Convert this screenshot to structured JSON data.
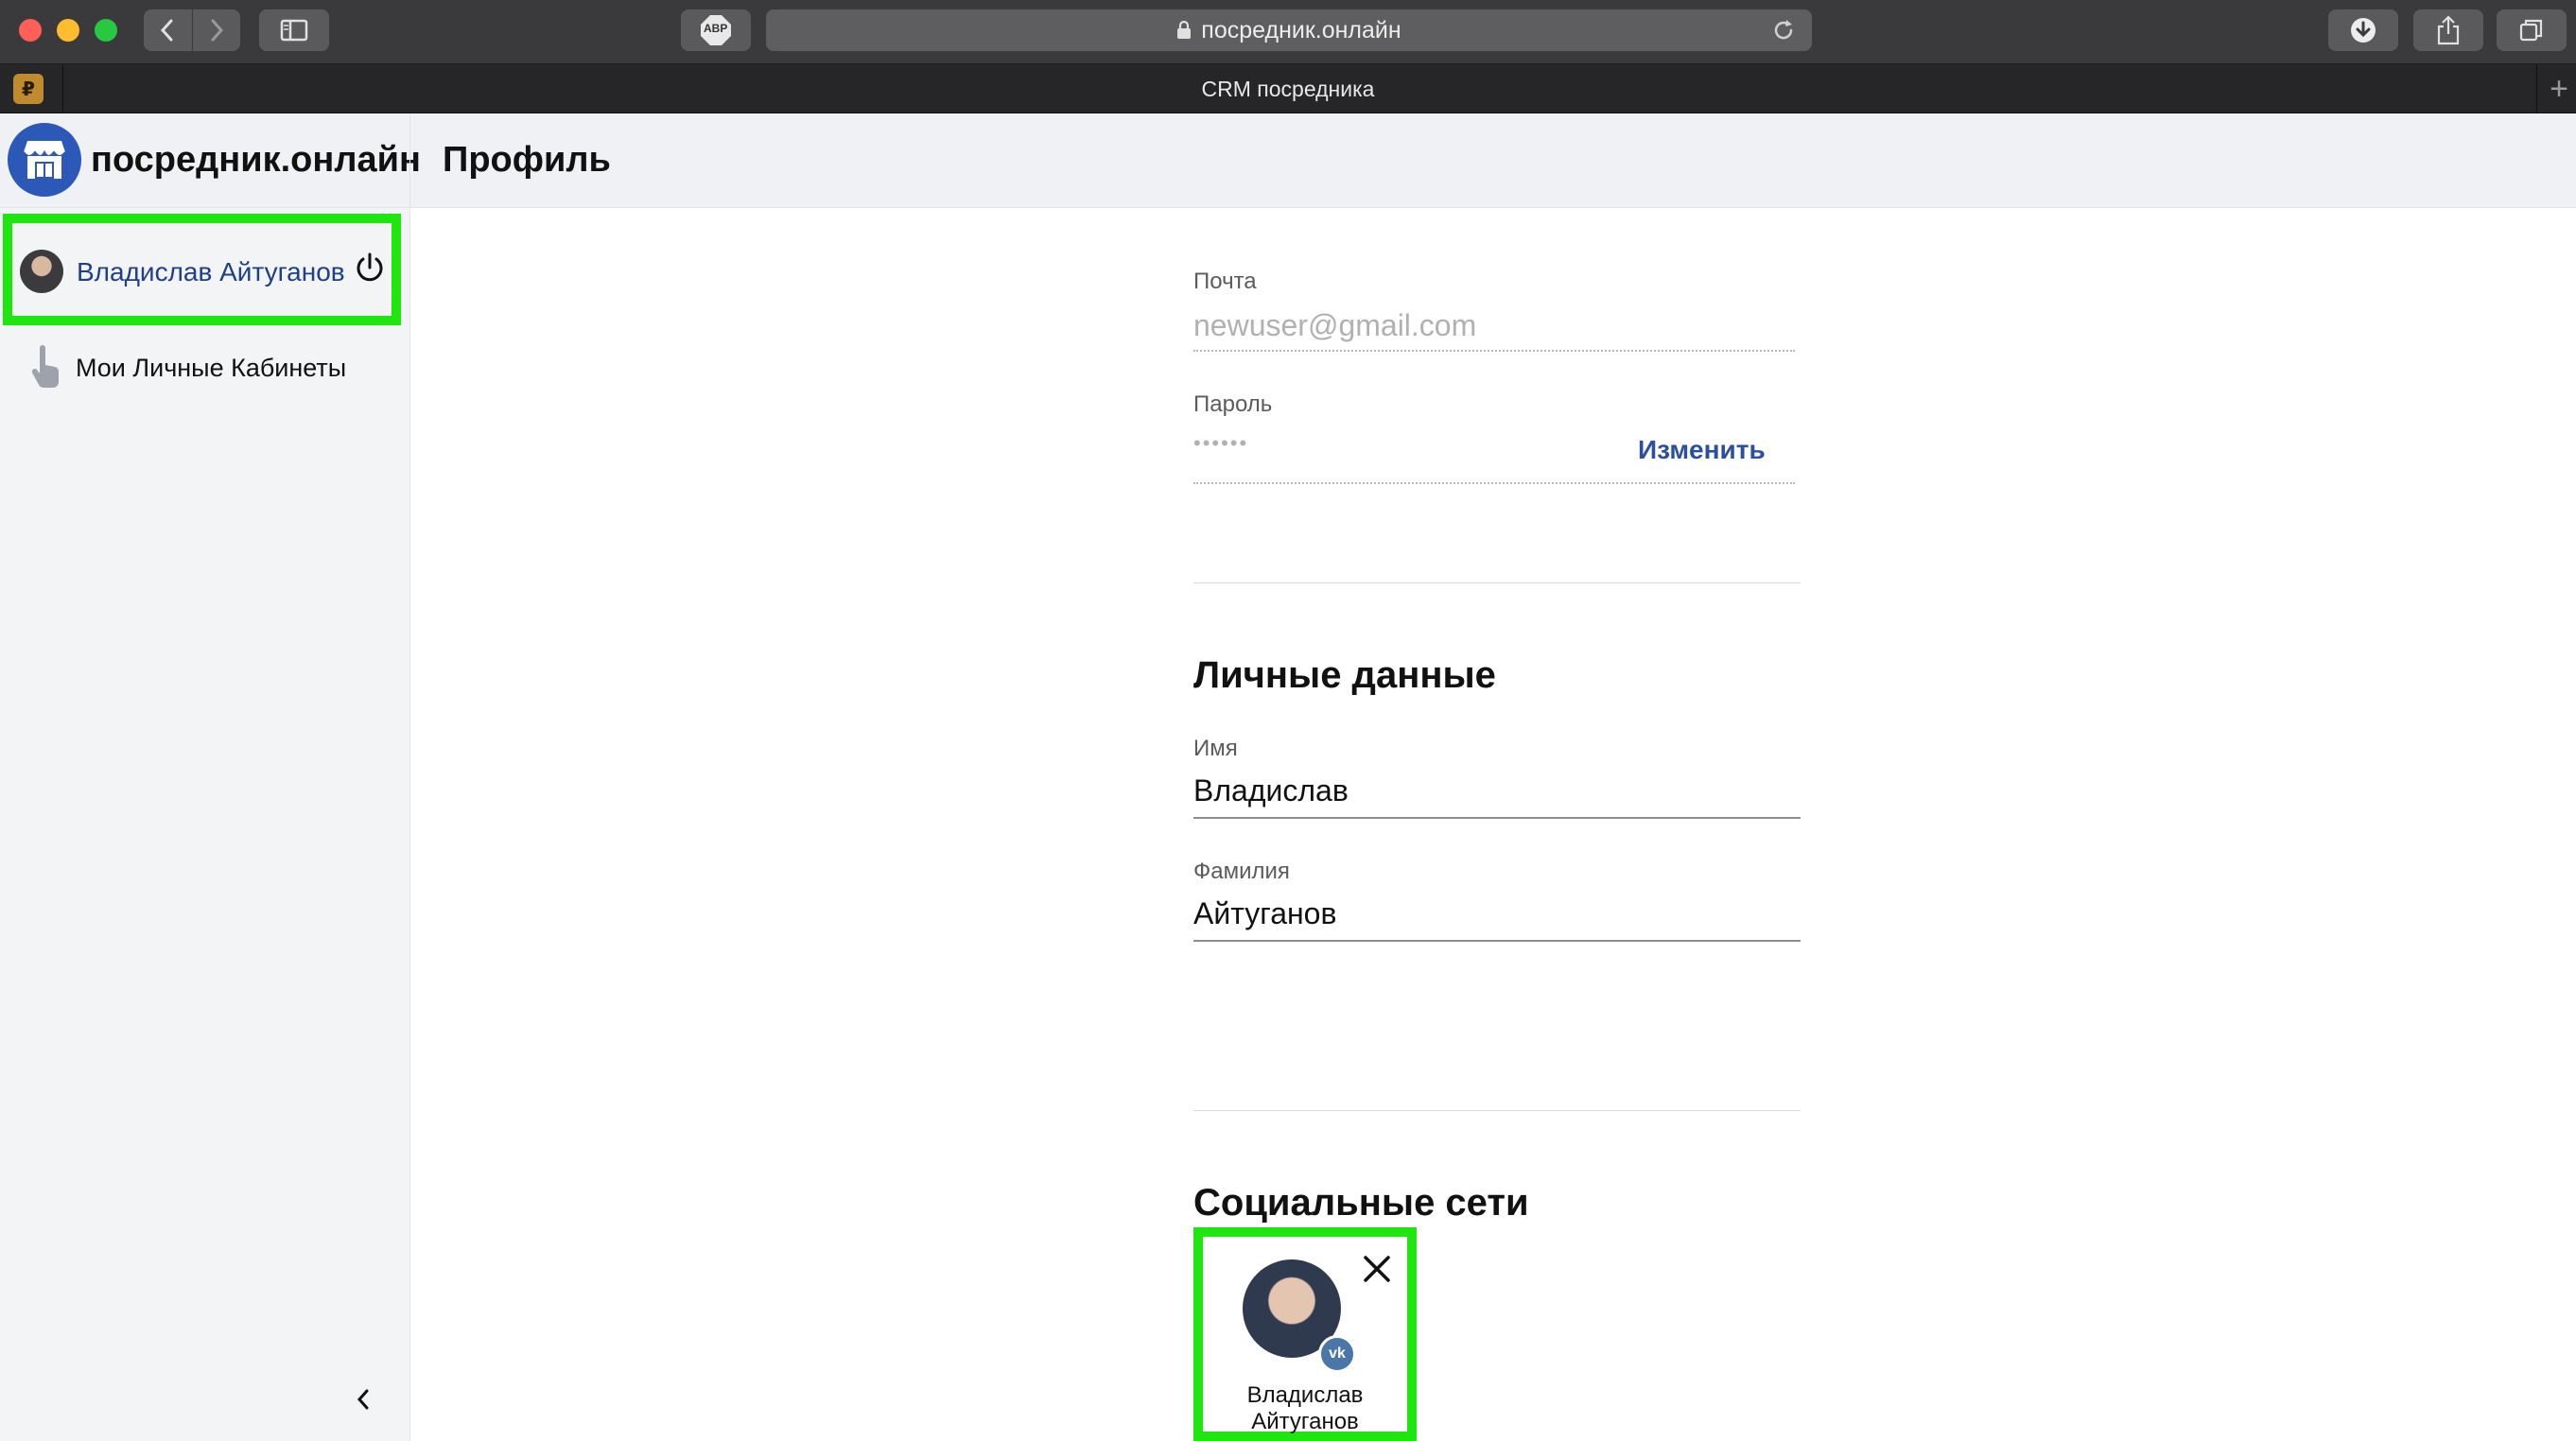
{
  "browser": {
    "url": "посредник.онлайн",
    "tab_title": "CRM посредника",
    "tab_favicon": "gift-box-icon",
    "adblock_label": "ABP",
    "tab_plus": "+"
  },
  "app": {
    "brand": "посредник.онлайн",
    "page_title": "Профиль"
  },
  "sidebar": {
    "user_name": "Владислав Айтуганов",
    "menu_items": [
      {
        "label": "Мои Личные Кабинеты",
        "icon": "hand-pointer-icon"
      }
    ]
  },
  "account": {
    "email_label": "Почта",
    "email_value": "newuser@gmail.com",
    "password_label": "Пароль",
    "password_value": "••••••",
    "change_label": "Изменить"
  },
  "personal": {
    "title": "Личные данные",
    "first_name_label": "Имя",
    "first_name_value": "Владислав",
    "last_name_label": "Фамилия",
    "last_name_value": "Айтуганов"
  },
  "social": {
    "title": "Социальные сети",
    "accounts": [
      {
        "name": "Владислав Айтуганов",
        "network": "vk",
        "badge": "vk"
      }
    ]
  },
  "colors": {
    "highlight": "#1ee60e",
    "link": "#2d4f9f",
    "brand_blue": "#2c59b8",
    "vk_blue": "#4a76a8"
  }
}
